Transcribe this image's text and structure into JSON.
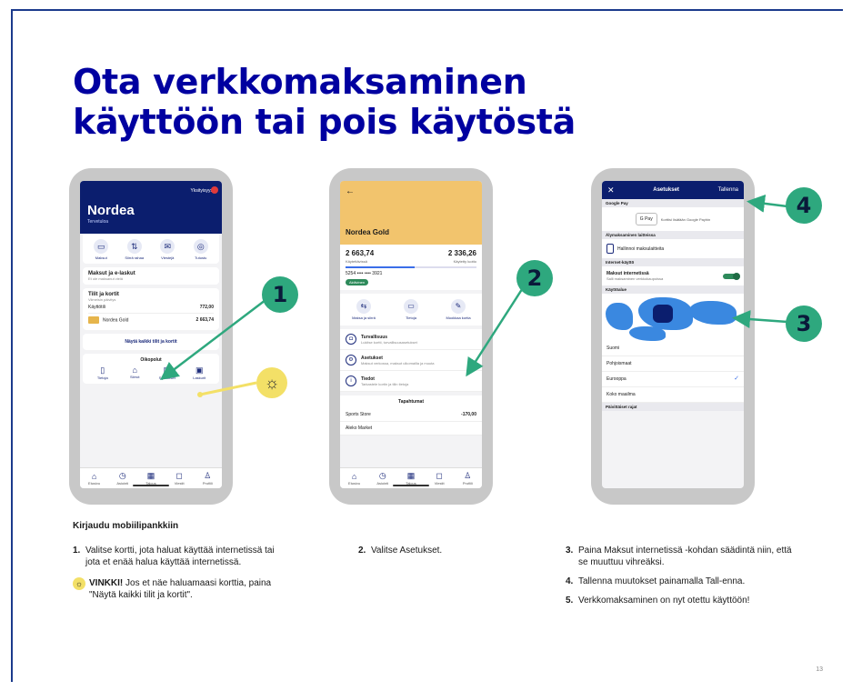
{
  "page": {
    "title": "Ota verkkomaksaminen käyttöön tai pois käytöstä",
    "page_number": "13"
  },
  "phone1": {
    "logo": "Nordea",
    "subtitle": "Tervetuloa",
    "privacy": "Yksityisyys",
    "quick_actions": [
      "Maksut",
      "Siirrä rahaa",
      "Viestejä",
      "Tutustu"
    ],
    "payments_card": {
      "title": "Maksut ja e-laskut",
      "sub": "Et ole maksanut vielä"
    },
    "accounts_card": {
      "title": "Tilit ja kortit",
      "sub": "Viimeisin päivitys",
      "rows": [
        {
          "label": "Käyttötili",
          "value": "772,00"
        },
        {
          "label": "Nordea Gold",
          "value": "2 663,74"
        }
      ]
    },
    "show_all": "Näytä kaikki tilit ja kortit",
    "shortcuts_title": "Oikopolut",
    "shortcuts": [
      "Tietoja",
      "Siirrot",
      "Sijoitukset",
      "Laskurit"
    ],
    "tabs": [
      "Etusivu",
      "Asiointi",
      "Talous",
      "Viestit",
      "Profiili"
    ]
  },
  "phone2": {
    "back": "←",
    "title": "Nordea Gold",
    "balance_left": "2 663,74",
    "balance_right": "2 336,26",
    "balance_left_label": "Käytettävissä",
    "balance_right_label": "Käytetty luotto",
    "used_fraction": 0.53,
    "card_number": "5254 •••• •••• 3921",
    "card_status": "Aktiivinen",
    "actions": [
      "Maksa ja siirrä",
      "Tietoja",
      "Muokkaa kortia"
    ],
    "menu": [
      {
        "title": "Turvallisuus",
        "sub": "Lukitse kortti, turvallisuusasetukset",
        "icon": "lock-icon"
      },
      {
        "title": "Asetukset",
        "sub": "Maksut verkossa, maksut ulkomailla ja muuta",
        "icon": "gear-icon"
      },
      {
        "title": "Tiedot",
        "sub": "Tarkastele kortin ja tilin tietoja",
        "icon": "info-icon"
      }
    ],
    "events_title": "Tapahtumat",
    "events": [
      {
        "label": "Sports Store",
        "value": "-170,00"
      },
      {
        "label": "Aleko Market",
        "value": ""
      }
    ],
    "tabs": [
      "Etusivu",
      "Asiointi",
      "Talous",
      "Viestit",
      "Profiili"
    ]
  },
  "phone3": {
    "close": "✕",
    "title": "Asetukset",
    "save": "Tallenna",
    "google_pay_header": "Google Pay",
    "google_pay_button": "G Pay",
    "google_pay_text": "Korttisi lisätään Google Payhin",
    "wearables_header": "Älymaksaminen laitteissa",
    "wearables_item": "Hallinnoi maksulaitteita",
    "internet_header": "Internet-käyttö",
    "internet_item": "Maksut internetissä",
    "internet_sub": "Salli maksaminen verkkokaupoissa",
    "internet_enabled": true,
    "region_header": "Käyttöalue",
    "regions": [
      "Suomi",
      "Pohjoismaat",
      "Eurooppa",
      "Koko maailma"
    ],
    "selected_region": "Eurooppa",
    "limits_header": "Päivittäiset rajat"
  },
  "callouts": [
    "1",
    "2",
    "3",
    "4"
  ],
  "text": {
    "login": "Kirjaudu mobiilipankkiin",
    "steps": [
      {
        "n": "1.",
        "t": "Valitse kortti, jota haluat käyttää internetissä tai jota et enää halua käyttää internetissä."
      },
      {
        "n": "2.",
        "t": "Valitse Asetukset."
      },
      {
        "n": "3.",
        "t": "Paina Maksut internetissä -kohdan säädintä niin, että se muuttuu vihreäksi."
      },
      {
        "n": "4.",
        "t": "Tallenna muutokset painamalla Tall-enna."
      },
      {
        "n": "5.",
        "t": "Verkkomaksaminen on nyt otettu käyttöön!"
      }
    ],
    "tip_label": "VINKKI!",
    "tip_text": "Jos et näe haluamaasi korttia, paina \"Näytä kaikki tilit ja kortit\"."
  },
  "colors": {
    "brand": "#0000a0",
    "callout": "#2ea87e",
    "tip": "#f3e067"
  }
}
